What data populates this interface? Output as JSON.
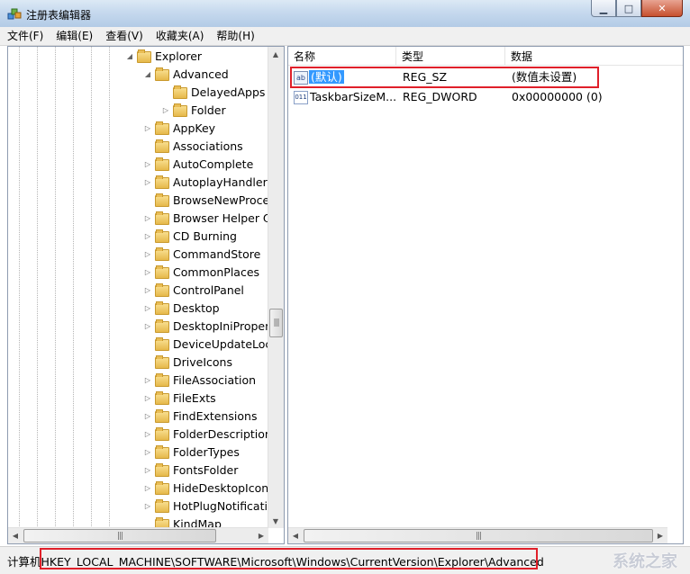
{
  "window": {
    "title": "注册表编辑器"
  },
  "menu": [
    "文件(F)",
    "编辑(E)",
    "查看(V)",
    "收藏夹(A)",
    "帮助(H)"
  ],
  "tree": {
    "items": [
      {
        "label": "Explorer",
        "expander": "◢"
      },
      {
        "label": "Advanced",
        "expander": "◢"
      },
      {
        "label": "DelayedApps",
        "expander": ""
      },
      {
        "label": "Folder",
        "expander": "▷"
      },
      {
        "label": "AppKey",
        "expander": "▷"
      },
      {
        "label": "Associations",
        "expander": ""
      },
      {
        "label": "AutoComplete",
        "expander": "▷"
      },
      {
        "label": "AutoplayHandlers",
        "expander": "▷"
      },
      {
        "label": "BrowseNewProcess",
        "expander": ""
      },
      {
        "label": "Browser Helper Objects",
        "expander": "▷"
      },
      {
        "label": "CD Burning",
        "expander": "▷"
      },
      {
        "label": "CommandStore",
        "expander": "▷"
      },
      {
        "label": "CommonPlaces",
        "expander": "▷"
      },
      {
        "label": "ControlPanel",
        "expander": "▷"
      },
      {
        "label": "Desktop",
        "expander": "▷"
      },
      {
        "label": "DesktopIniPropertyMap",
        "expander": "▷"
      },
      {
        "label": "DeviceUpdateLocations",
        "expander": ""
      },
      {
        "label": "DriveIcons",
        "expander": ""
      },
      {
        "label": "FileAssociation",
        "expander": "▷"
      },
      {
        "label": "FileExts",
        "expander": "▷"
      },
      {
        "label": "FindExtensions",
        "expander": "▷"
      },
      {
        "label": "FolderDescriptions",
        "expander": "▷"
      },
      {
        "label": "FolderTypes",
        "expander": "▷"
      },
      {
        "label": "FontsFolder",
        "expander": "▷"
      },
      {
        "label": "HideDesktopIcons",
        "expander": "▷"
      },
      {
        "label": "HotPlugNotification",
        "expander": "▷"
      },
      {
        "label": "KindMap",
        "expander": ""
      }
    ]
  },
  "list": {
    "headers": {
      "name": "名称",
      "type": "类型",
      "data": "数据"
    },
    "rows": [
      {
        "icon": "ab",
        "name": "(默认)",
        "type": "REG_SZ",
        "data": "(数值未设置)"
      },
      {
        "icon": "011",
        "name": "TaskbarSizeM...",
        "type": "REG_DWORD",
        "data": "0x00000000 (0)"
      }
    ]
  },
  "scroll": {
    "grip": "|||"
  },
  "status": {
    "prefix": "计算机",
    "path": "HKEY_LOCAL_MACHINE\\SOFTWARE\\Microsoft\\Windows\\CurrentVersion\\Explorer\\Advanced"
  },
  "watermark": "系统之家",
  "colors": {
    "highlight": "#e0202a",
    "selection": "#3399ff"
  }
}
